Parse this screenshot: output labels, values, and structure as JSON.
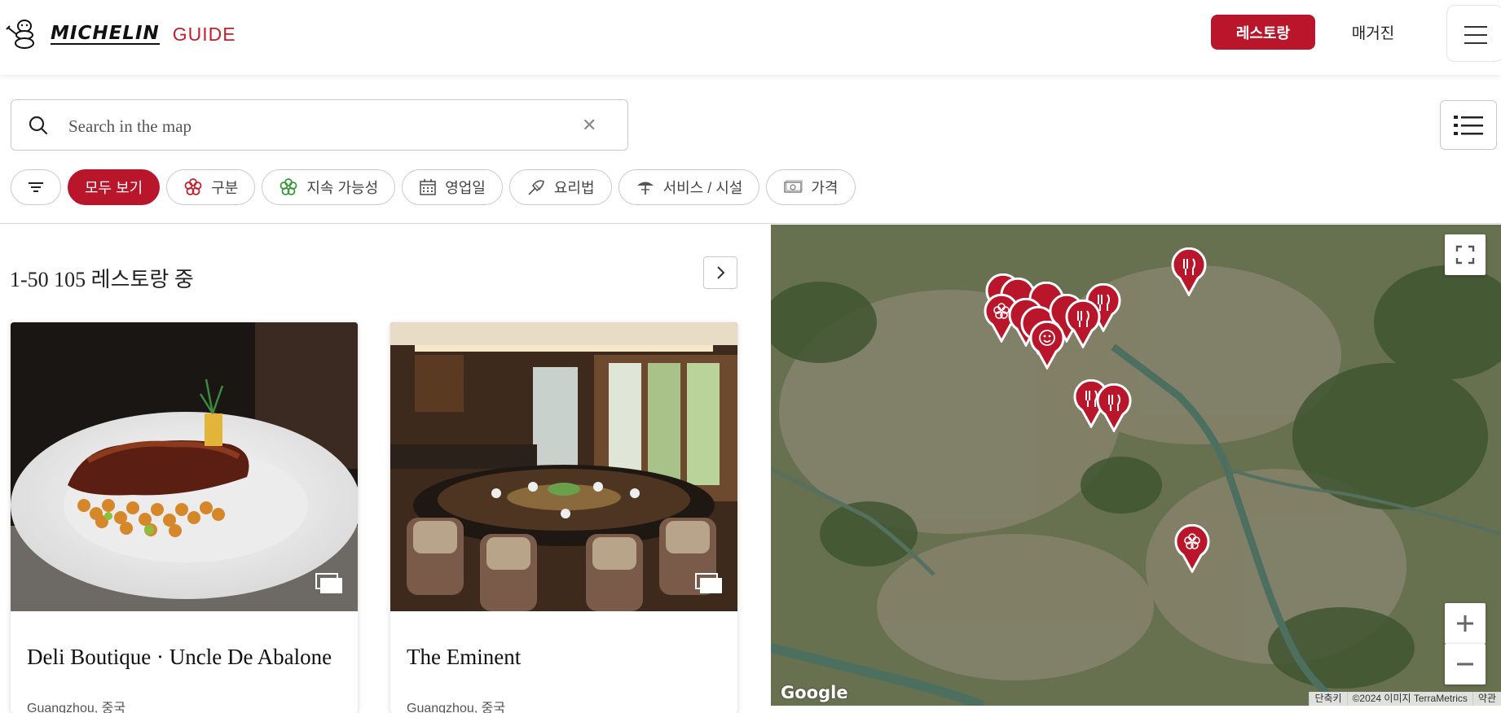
{
  "header": {
    "logo_text": "MICHELIN",
    "logo_sub": "GUIDE",
    "restaurants_label": "레스토랑",
    "magazine_label": "매거진"
  },
  "search": {
    "placeholder": "Search in the map",
    "value": ""
  },
  "filters": [
    {
      "label": "모두 보기",
      "icon": "none",
      "active": true
    },
    {
      "label": "구분",
      "icon": "michelin-flower-icon"
    },
    {
      "label": "지속 가능성",
      "icon": "green-clover-icon"
    },
    {
      "label": "영업일",
      "icon": "calendar-icon"
    },
    {
      "label": "요리법",
      "icon": "cooking-icon"
    },
    {
      "label": "서비스 / 시설",
      "icon": "umbrella-icon"
    },
    {
      "label": "가격",
      "icon": "banknote-icon"
    }
  ],
  "results": {
    "summary": "1-50 105 레스토랑 중"
  },
  "cards": [
    {
      "name": "Deli Boutique · Uncle De Abalone",
      "location": "Guangzhou, 중국"
    },
    {
      "name": "The Eminent",
      "location": "Guangzhou, 중국"
    }
  ],
  "map": {
    "google_label": "Google",
    "shortcuts_label": "단축키",
    "copyright_label": "©2024 이미지 TerraMetrics",
    "terms_label": "약관"
  },
  "colors": {
    "accent": "#b9152b",
    "map_base": "#5d6a4c"
  }
}
